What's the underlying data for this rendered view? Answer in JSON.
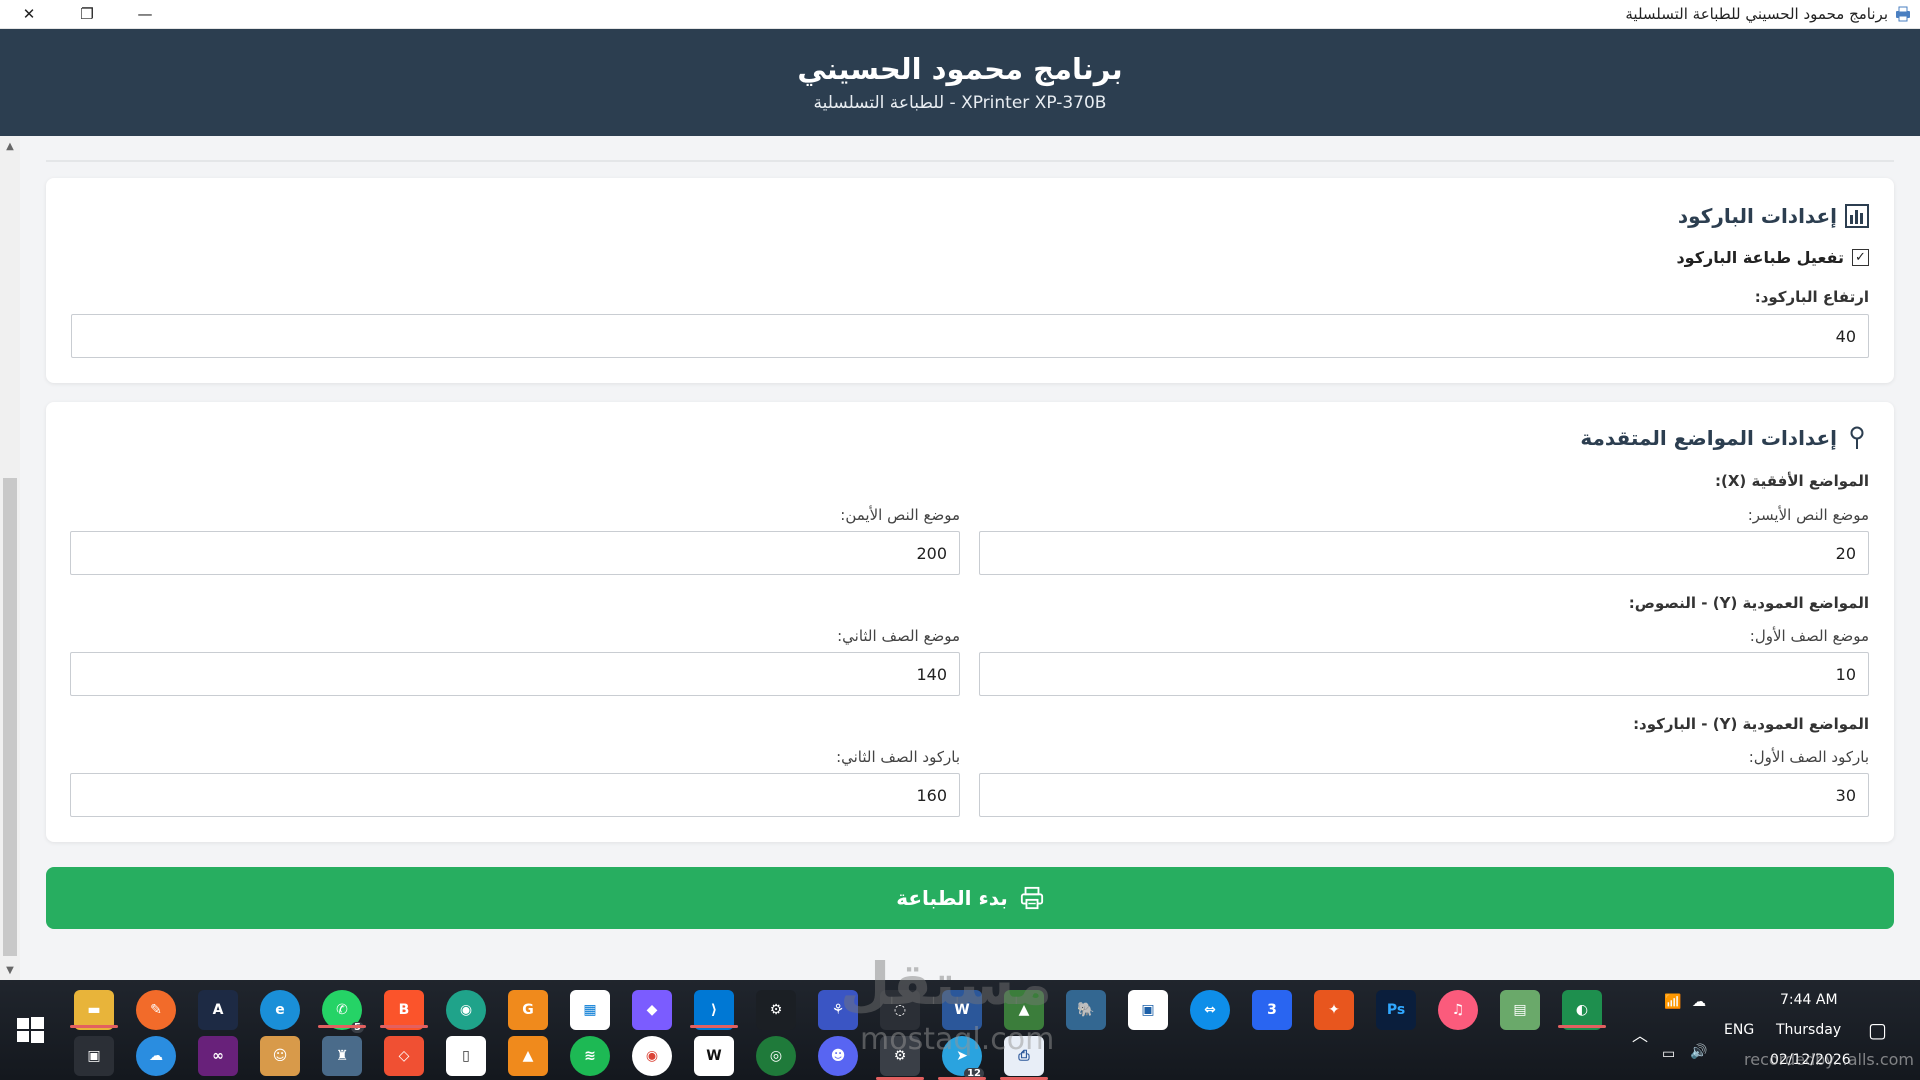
{
  "window": {
    "title": "برنامج محمود الحسيني للطباعة التسلسلية",
    "close_glyph": "✕",
    "restore_glyph": "❐",
    "minimize_glyph": "—"
  },
  "header": {
    "title": "برنامج محمود الحسيني",
    "subtitle": "للطباعة التسلسلية - XPrinter XP-370B"
  },
  "barcode_settings": {
    "title": "إعدادات الباركود",
    "icon": "bar-chart-icon",
    "enable_label": "تفعيل طباعة الباركود",
    "enabled": true,
    "height_label": "ارتفاع الباركود:",
    "height_value": "40"
  },
  "advanced_positions": {
    "title": "إعدادات المواضع المتقدمة",
    "icon": "pin-icon",
    "horizontal_heading": "المواضع الأفقية (X):",
    "left_text_label": "موضع النص الأيسر:",
    "left_text_value": "20",
    "right_text_label": "موضع النص الأيمن:",
    "right_text_value": "200",
    "vertical_text_heading": "المواضع العمودية (Y) - النصوص:",
    "first_row_label": "موضع الصف الأول:",
    "first_row_value": "10",
    "second_row_label": "موضع الصف الثاني:",
    "second_row_value": "140",
    "vertical_barcode_heading": "المواضع العمودية (Y) - الباركود:",
    "barcode_first_row_label": "باركود الصف الأول:",
    "barcode_first_row_value": "30",
    "barcode_second_row_label": "باركود الصف الثاني:",
    "barcode_second_row_value": "160"
  },
  "start_button": {
    "label": "بدء الطباعة",
    "icon": "printer-icon"
  },
  "taskbar": {
    "whatsapp_badge": "5",
    "telegram_badge": "12",
    "language": "ENG",
    "time": "7:44 AM",
    "day": "Thursday",
    "date": "02/12/2026"
  },
  "watermark": {
    "brand": "مستقل",
    "domain": "mostaql.com",
    "recorder": "recordedby...alls.com"
  },
  "colors": {
    "header_bg": "#2c3e50",
    "button_green": "#27ae60",
    "page_bg": "#f3f4f6"
  }
}
